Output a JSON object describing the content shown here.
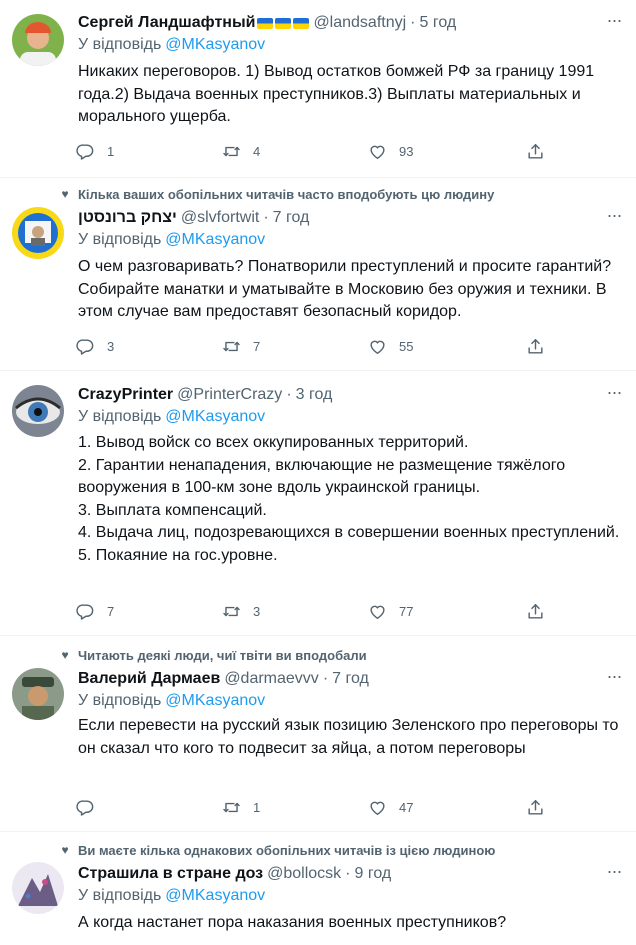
{
  "reply_prefix": "У відповідь",
  "tweets": [
    {
      "social_context": "",
      "name": "Сергей Ландшафтный",
      "handle": "@landsaftnyj",
      "time": "5 год",
      "reply_to": "@MKasyanov",
      "lines": [
        "Никаких переговоров. 1) Вывод остатков бомжей РФ за границу 1991 года.2) Выдача военных преступников.3) Выплаты материальных и морального ущерба."
      ],
      "replies": "1",
      "retweets": "4",
      "likes": "93"
    },
    {
      "social_context": "Кілька ваших обопільних читачів часто вподобують цю людину",
      "name": "יצחק ברונסטן",
      "handle": "@slvfortwit",
      "time": "7 год",
      "reply_to": "@MKasyanov",
      "lines": [
        "О чем разговаривать? Понатворили преступлений и просите гарантий? Собирайте манатки и уматывайте в Московию без оружия и техники. В этом случае вам предоставят безопасный коридор."
      ],
      "replies": "3",
      "retweets": "7",
      "likes": "55"
    },
    {
      "social_context": "",
      "name": "CrazyPrinter",
      "handle": "@PrinterCrazy",
      "time": "3 год",
      "reply_to": "@MKasyanov",
      "lines": [
        "1. Вывод войск со всех оккупированных территорий.",
        "2. Гарантии ненападения, включающие не размещение тяжёлого вооружения в 100-км зоне вдоль украинской границы.",
        "3. Выплата компенсаций.",
        "4. Выдача лиц, подозревающихся в совершении военных преступлений.",
        "5. Покаяние на гос.уровне."
      ],
      "replies": "7",
      "retweets": "3",
      "likes": "77"
    },
    {
      "social_context": "Читають деякі люди, чиї твіти ви вподобали",
      "name": "Валерий Дармаев",
      "handle": "@darmaevvv",
      "time": "7 год",
      "reply_to": "@MKasyanov",
      "lines": [
        "Если перевести на русский язык позицию Зеленского про переговоры то он сказал что кого то подвесит за яйца, а потом переговоры"
      ],
      "replies": "",
      "retweets": "1",
      "likes": "47"
    },
    {
      "social_context": "Ви маєте кілька однакових обопільних читачів із цією людиною",
      "name": "Страшила в стране доз",
      "handle": "@bollocsk",
      "time": "9 год",
      "reply_to": "@MKasyanov",
      "lines": [
        "А когда настанет пора наказания военных преступников?"
      ],
      "replies": "",
      "retweets": "",
      "likes": ""
    }
  ],
  "icons": {
    "reply": "speech-bubble-icon",
    "retweet": "retweet-arrows-icon",
    "like": "heart-outline-icon",
    "share": "share-upload-icon",
    "more": "more-dots-icon",
    "social": "heart-small-icon"
  },
  "colors": {
    "secondary_text": "#536471",
    "mention": "#1d9bf0",
    "divider": "#eff3f4",
    "flag_blue": "#1d6fd6",
    "flag_yellow": "#ffd500"
  }
}
